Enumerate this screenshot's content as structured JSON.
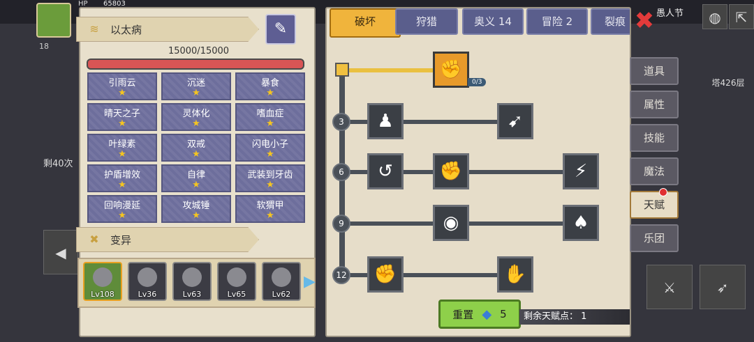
{
  "hud": {
    "hp_label": "HP",
    "gold": "65803",
    "level": "18",
    "remain_times": "剩40次",
    "tower": "塔426层",
    "event": "愚人节"
  },
  "left_panel": {
    "title": "以太病",
    "hp": "15000/15000",
    "hp_ratio": 1.0,
    "traits": [
      {
        "name": "引雨云",
        "stars": 1
      },
      {
        "name": "沉迷",
        "stars": 1
      },
      {
        "name": "暴食",
        "stars": 1
      },
      {
        "name": "晴天之子",
        "stars": 1
      },
      {
        "name": "灵体化",
        "stars": 1
      },
      {
        "name": "嗜血症",
        "stars": 1
      },
      {
        "name": "叶绿素",
        "stars": 1
      },
      {
        "name": "双戒",
        "stars": 1
      },
      {
        "name": "闪电小子",
        "stars": 1
      },
      {
        "name": "护盾增效",
        "stars": 1
      },
      {
        "name": "自律",
        "stars": 1
      },
      {
        "name": "武装到牙齿",
        "stars": 1
      },
      {
        "name": "回响漫延",
        "stars": 1
      },
      {
        "name": "攻城锤",
        "stars": 1
      },
      {
        "name": "软猬甲",
        "stars": 1
      }
    ],
    "mutation_title": "变异",
    "heroes": [
      {
        "lv": "Lv108"
      },
      {
        "lv": "Lv36"
      },
      {
        "lv": "Lv63"
      },
      {
        "lv": "Lv65"
      },
      {
        "lv": "Lv62"
      }
    ]
  },
  "tabs": [
    {
      "label": "破坏"
    },
    {
      "label": "狩猎"
    },
    {
      "label": "奥义 14"
    },
    {
      "label": "冒险 2"
    },
    {
      "label": "裂痕"
    }
  ],
  "talent_tree": {
    "top_node_count": "0/3",
    "level_markers": [
      "3",
      "6",
      "9",
      "12"
    ]
  },
  "reset": {
    "label": "重置",
    "cost": "5",
    "remaining_label": "剩余天赋点：",
    "remaining": "1"
  },
  "side_menu": [
    {
      "label": "道具"
    },
    {
      "label": "属性"
    },
    {
      "label": "技能"
    },
    {
      "label": "魔法"
    },
    {
      "label": "天赋"
    },
    {
      "label": "乐团"
    }
  ],
  "colors": {
    "accent": "#f0b43c",
    "panel": "#e6ddc9",
    "tab": "#5a5e8c",
    "reset": "#8ed04a"
  }
}
